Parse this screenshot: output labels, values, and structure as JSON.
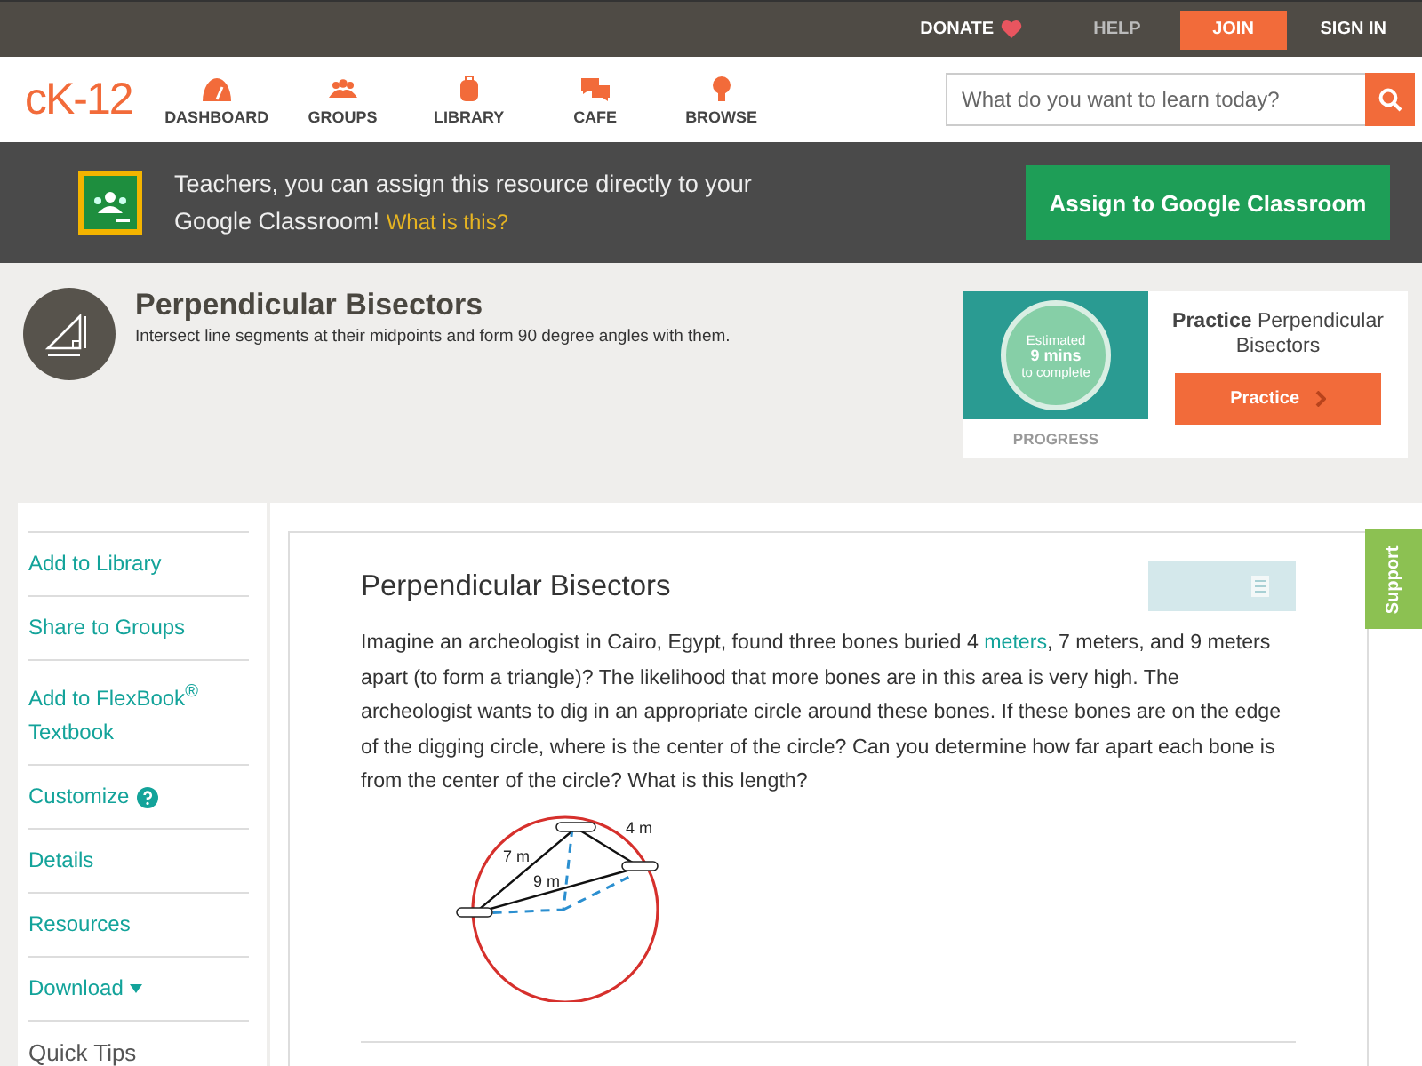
{
  "top_bar": {
    "donate": "DONATE",
    "help": "HELP",
    "join": "JOIN",
    "sign_in": "SIGN IN"
  },
  "nav": {
    "logo": "cK-12",
    "items": [
      {
        "label": "DASHBOARD"
      },
      {
        "label": "GROUPS"
      },
      {
        "label": "LIBRARY"
      },
      {
        "label": "CAFE"
      },
      {
        "label": "BROWSE"
      }
    ],
    "search": {
      "placeholder": "What do you want to learn today?"
    }
  },
  "banner": {
    "text": "Teachers, you can assign this resource directly to your Google Classroom!",
    "link": "What is this?",
    "button": "Assign to Google Classroom"
  },
  "concept": {
    "title": "Perpendicular Bisectors",
    "subtitle": "Intersect line segments at their midpoints and form 90 degree angles with them."
  },
  "practice": {
    "estimate_top": "Estimated",
    "estimate_mins": "9 mins",
    "estimate_bottom": "to complete",
    "progress": "PROGRESS",
    "title_bold": "Practice",
    "title_rest": "Perpendicular Bisectors",
    "button": "Practice"
  },
  "sidebar": {
    "items": [
      {
        "label": "Add to Library",
        "kind": "link"
      },
      {
        "label": "Share to Groups",
        "kind": "link"
      },
      {
        "label": "Add to FlexBook$^{®}$ Textbook",
        "kind": "link"
      },
      {
        "label": "Customize",
        "kind": "help"
      },
      {
        "label": "Details",
        "kind": "link"
      },
      {
        "label": "Resources",
        "kind": "link"
      },
      {
        "label": "Download",
        "kind": "dropdown"
      },
      {
        "label": "Quick Tips",
        "kind": "heading"
      }
    ]
  },
  "article": {
    "title": "Perpendicular Bisectors",
    "text_before": "Imagine an archeologist in Cairo, Egypt, found three bones buried 4",
    "link": "meters",
    "text_after": ", 7 meters, and 9 meters apart (to form a triangle)? The likelihood that more bones are in this area is very high. The archeologist wants to dig in an appropriate circle around these bones. If these bones are on the edge of the digging circle, where is the center of the circle? Can you determine how far apart each bone is from the center of the circle? What is this length?",
    "diagram_labels": [
      "7 m",
      "4 m",
      "9 m"
    ]
  },
  "support_tab": "Support"
}
